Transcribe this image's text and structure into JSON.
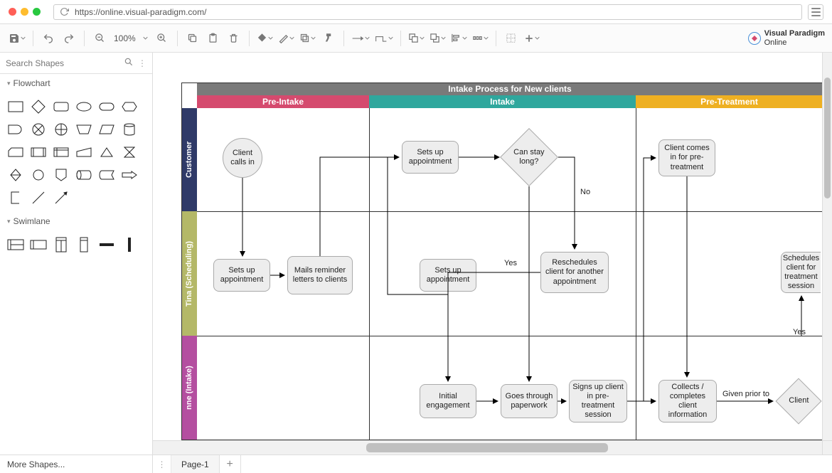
{
  "url": "https://online.visual-paradigm.com/",
  "branding": {
    "name": "Visual Paradigm",
    "sub": "Online"
  },
  "toolbar": {
    "zoom": "100%"
  },
  "sidebar": {
    "search_placeholder": "Search Shapes",
    "sections": {
      "flowchart": "Flowchart",
      "swimlane": "Swimlane"
    },
    "more_shapes": "More Shapes..."
  },
  "page_tab": "Page-1",
  "diagram": {
    "title": "Intake Process for New clients",
    "phases": [
      {
        "id": "pre-intake",
        "label": "Pre-Intake",
        "color": "#d54a6e"
      },
      {
        "id": "intake",
        "label": "Intake",
        "color": "#2fa79d"
      },
      {
        "id": "pre-treatment",
        "label": "Pre-Treatment",
        "color": "#eeb022"
      }
    ],
    "lanes": [
      {
        "id": "customer",
        "label": "Customer",
        "color": "#2f3a68"
      },
      {
        "id": "tina",
        "label": "Tina (Scheduling)",
        "color": "#b4b868"
      },
      {
        "id": "anne",
        "label": "nne (Intake)",
        "color": "#b44fa0"
      }
    ],
    "nodes": {
      "client_calls_in": "Client calls in",
      "sets_up_appt_1": "Sets up appointment",
      "mails_reminder": "Mails reminder letters to clients",
      "sets_up_appt_cust": "Sets up appointment",
      "can_stay_long": "Can stay long?",
      "sets_up_appt_2": "Sets up appointment",
      "reschedules": "Reschedules client for another appointment",
      "initial_engagement": "Initial engagement",
      "goes_paperwork": "Goes through paperwork",
      "signs_up": "Signs up client in pre-treatment session",
      "client_comes_in": "Client comes in for pre-treatment",
      "collects_info": "Collects / completes client information",
      "sched_treat": "Schedules client for treatment session",
      "client_partial": "Client"
    },
    "edges": {
      "yes": "Yes",
      "no": "No",
      "given_prior_to": "Given prior to"
    }
  }
}
